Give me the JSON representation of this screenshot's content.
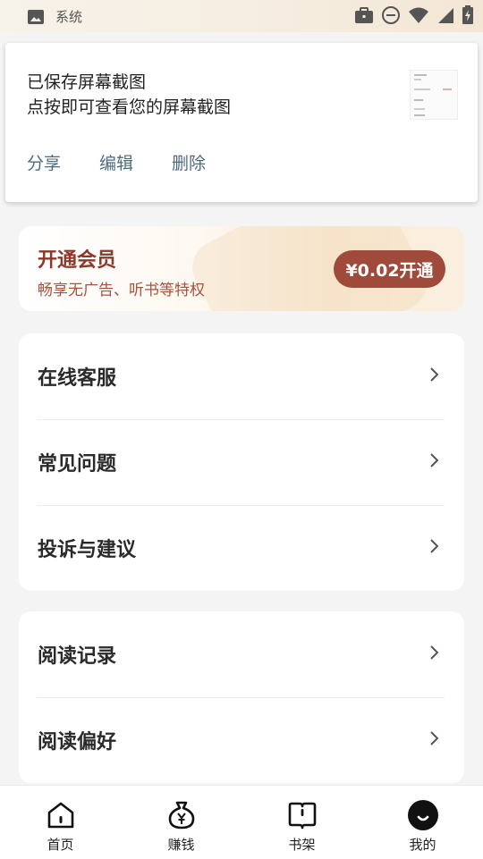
{
  "status_bar": {
    "label": "系统",
    "icons": [
      "image-icon",
      "work-icon",
      "do-not-disturb-icon",
      "wifi-icon",
      "signal-icon",
      "battery-charging-icon"
    ]
  },
  "notification": {
    "title": "已保存屏幕截图",
    "text": "点按即可查看您的屏幕截图",
    "actions": [
      "分享",
      "编辑",
      "删除"
    ],
    "thumbnail": "screenshot-thumbnail"
  },
  "vip": {
    "title": "开通会员",
    "subtitle": "畅享无广告、听书等特权",
    "button": "¥0.02开通",
    "colors": {
      "title": "#8a3a2a",
      "subtitle": "#a8523c",
      "button_bg": "#9f4a3a"
    }
  },
  "menu_groups": [
    {
      "items": [
        {
          "label": "在线客服"
        },
        {
          "label": "常见问题"
        },
        {
          "label": "投诉与建议"
        }
      ]
    },
    {
      "items": [
        {
          "label": "阅读记录"
        },
        {
          "label": "阅读偏好"
        }
      ]
    }
  ],
  "bottom_nav": {
    "items": [
      {
        "label": "首页",
        "icon": "home-icon"
      },
      {
        "label": "赚钱",
        "icon": "money-bag-icon"
      },
      {
        "label": "书架",
        "icon": "book-icon"
      },
      {
        "label": "我的",
        "icon": "profile-icon",
        "active": true
      }
    ]
  }
}
